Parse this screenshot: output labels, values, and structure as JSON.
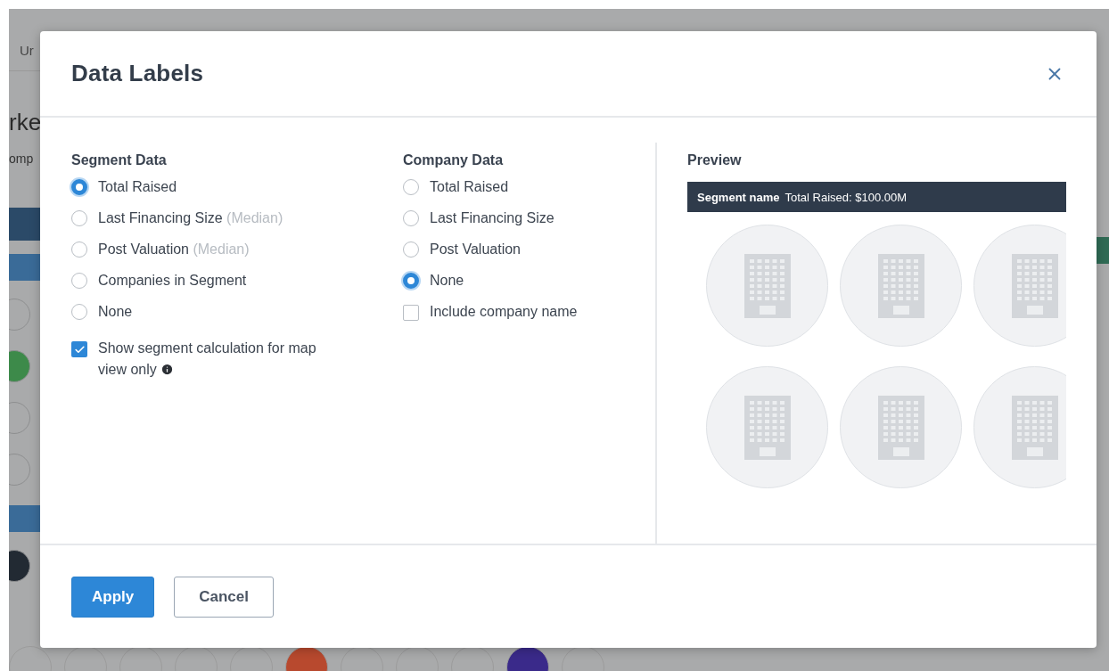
{
  "background": {
    "tab_text": "Ur",
    "heading_text": "rke",
    "subheading_text": "omp"
  },
  "dialog": {
    "title": "Data Labels",
    "segment_data": {
      "heading": "Segment Data",
      "options": [
        {
          "label": "Total Raised",
          "selected": true
        },
        {
          "label": "Last Financing Size",
          "note": "(Median)",
          "selected": false
        },
        {
          "label": "Post Valuation",
          "note": "(Median)",
          "selected": false
        },
        {
          "label": "Companies in Segment",
          "selected": false
        },
        {
          "label": "None",
          "selected": false
        }
      ],
      "show_calculation": {
        "label": "Show segment calculation for map view only",
        "checked": true
      }
    },
    "company_data": {
      "heading": "Company Data",
      "options": [
        {
          "label": "Total Raised",
          "selected": false
        },
        {
          "label": "Last Financing Size",
          "selected": false
        },
        {
          "label": "Post Valuation",
          "selected": false
        },
        {
          "label": "None",
          "selected": true
        }
      ],
      "include_company_name": {
        "label": "Include company name",
        "checked": false
      }
    },
    "preview": {
      "heading": "Preview",
      "segment_name": "Segment name",
      "value_text": "Total Raised: $100.00M"
    },
    "buttons": [
      {
        "label": "Apply",
        "kind": "primary"
      },
      {
        "label": "Cancel",
        "kind": "secondary"
      }
    ]
  }
}
